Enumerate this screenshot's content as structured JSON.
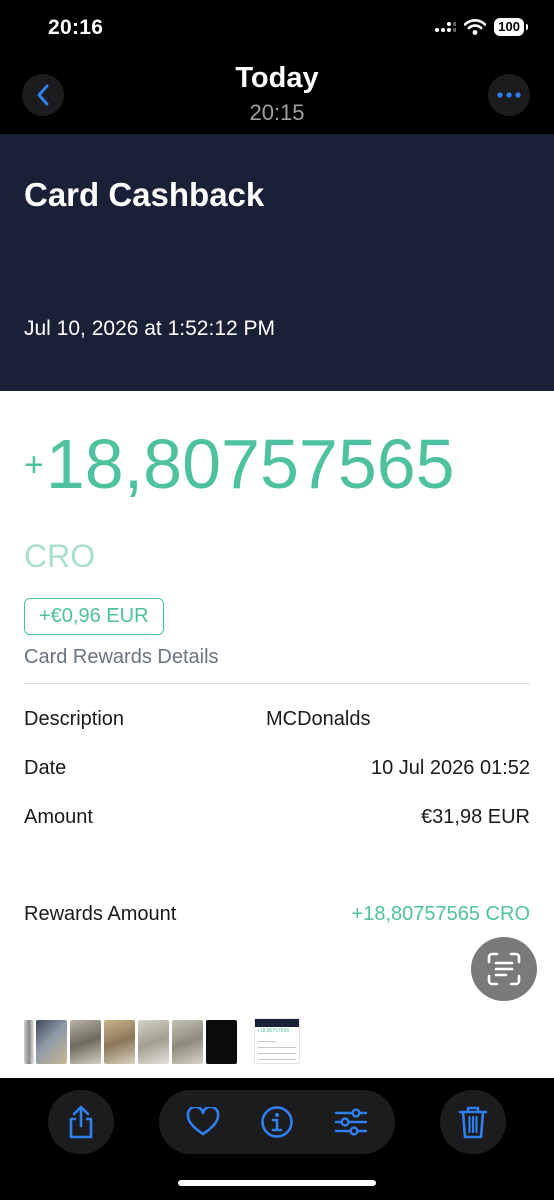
{
  "status_bar": {
    "time": "20:16",
    "battery": "100"
  },
  "nav": {
    "title": "Today",
    "subtitle": "20:15"
  },
  "receipt": {
    "title": "Card Cashback",
    "datetime": "Jul 10, 2026 at 1:52:12 PM",
    "amount_sign": "+",
    "amount": "18,80757565",
    "currency": "CRO",
    "fiat_value": "+€0,96 EUR",
    "rewards_link": "Card Rewards Details",
    "details": [
      {
        "label": "Description",
        "value": "MCDonalds"
      },
      {
        "label": "Date",
        "value": "10 Jul 2026 01:52"
      },
      {
        "label": "Amount",
        "value": "€31,98 EUR"
      },
      {
        "label": "Rewards Amount",
        "value": "+18,80757565 CRO"
      }
    ]
  },
  "thumbnail_strip": {
    "selected_amount": "+18,80757565"
  },
  "colors": {
    "accent_blue": "#2f7ff0",
    "cro_green": "#4ec19e",
    "hero_navy": "#1a2036"
  },
  "toolbar": {
    "icons": [
      "share-icon",
      "heart-icon",
      "info-icon",
      "adjust-icon",
      "trash-icon"
    ]
  }
}
